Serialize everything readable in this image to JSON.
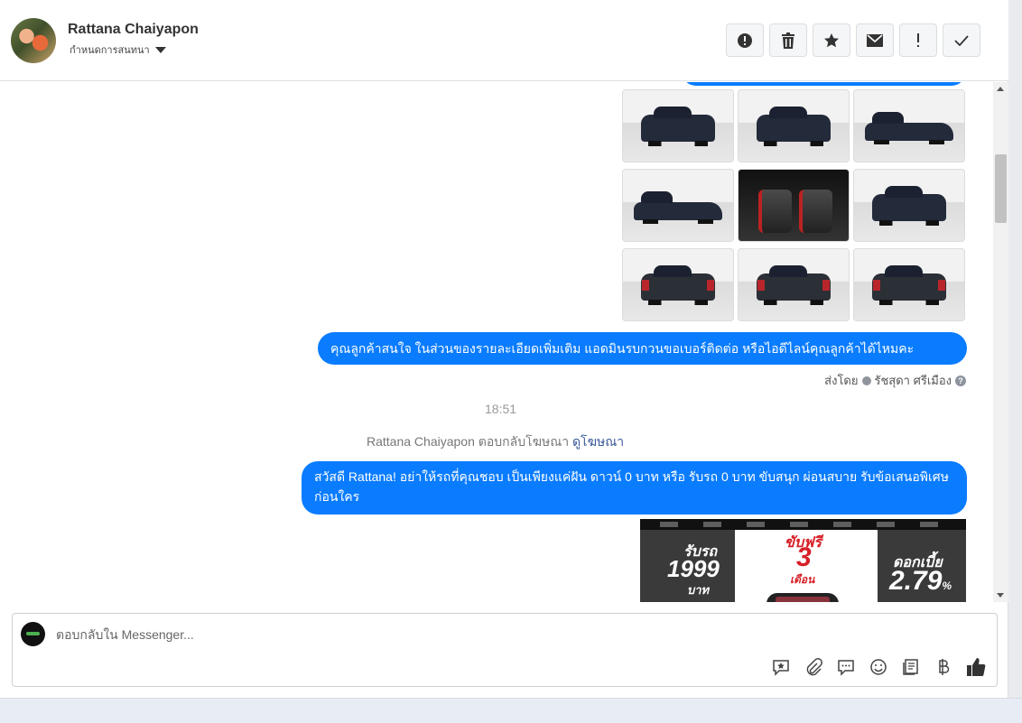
{
  "header": {
    "contact_name": "Rattana Chaiyapon",
    "conversation_label": "กำหนดการสนทนา",
    "actions": [
      "spam-icon",
      "trash-icon",
      "star-icon",
      "envelope-icon",
      "exclamation-icon",
      "check-icon"
    ]
  },
  "thread": {
    "photo_grid": [
      "front-left",
      "front",
      "side",
      "side",
      "interior",
      "front-right",
      "rear-left",
      "rear-left",
      "rear"
    ],
    "message_1": "คุณลูกค้าสนใจ ในส่วนของรายละเอียดเพิ่มเติม แอดมินรบกวนขอเบอร์ติดต่อ หรือไอดีไลน์คุณลูกค้าได้ไหมคะ",
    "sent_by_label": "ส่งโดย",
    "sent_by_name": "รัชสุดา ศรีเมือง",
    "timestamp": "18:51",
    "ad_reply_text": "Rattana Chaiyapon ตอบกลับโฆษณา",
    "ad_link": "ดูโฆษณา",
    "message_2": "สวัสดี Rattana! อย่าให้รถที่คุณชอบ เป็นเพียงแค่ฝัน ดาวน์ 0 บาท หรือ รับรถ 0 บาท ขับสนุก ผ่อนสบาย รับข้อเสนอพิเศษก่อนใคร",
    "ad": {
      "left_line1": "รับรถ",
      "left_line2": "1999",
      "left_line3": "บาท",
      "mid_line1": "ขับฟรี",
      "mid_line2": "3",
      "mid_line3": "เดือน",
      "right_line1": "ดอกเบี้ย",
      "right_line2": "2.79",
      "right_unit": "%"
    }
  },
  "composer": {
    "placeholder": "ตอบกลับใน Messenger...",
    "tools": [
      "saved-reply-icon",
      "attachment-icon",
      "chat-bubble-icon",
      "emoji-icon",
      "catalog-icon",
      "baht-icon",
      "like-icon"
    ]
  },
  "colors": {
    "bubble": "#0a7cff",
    "link": "#385898"
  }
}
